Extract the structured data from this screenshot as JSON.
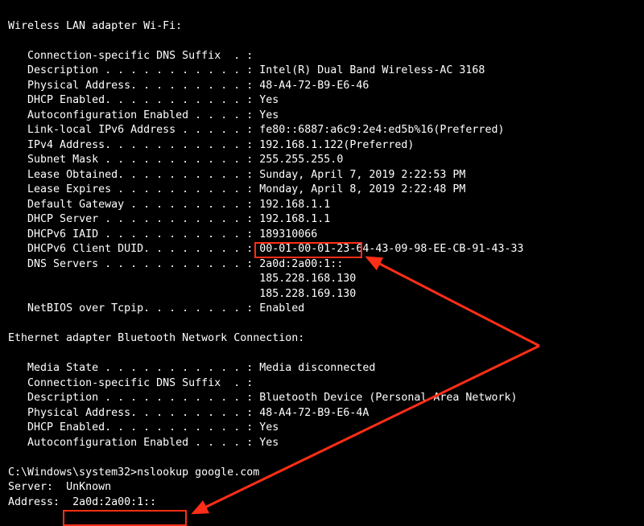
{
  "wifi": {
    "header": "Wireless LAN adapter Wi-Fi:",
    "rows": [
      {
        "label": "Connection-specific DNS Suffix  . :",
        "value": ""
      },
      {
        "label": "Description . . . . . . . . . . . :",
        "value": "Intel(R) Dual Band Wireless-AC 3168"
      },
      {
        "label": "Physical Address. . . . . . . . . :",
        "value": "48-A4-72-B9-E6-46"
      },
      {
        "label": "DHCP Enabled. . . . . . . . . . . :",
        "value": "Yes"
      },
      {
        "label": "Autoconfiguration Enabled . . . . :",
        "value": "Yes"
      },
      {
        "label": "Link-local IPv6 Address . . . . . :",
        "value": "fe80::6887:a6c9:2e4:ed5b%16(Preferred)"
      },
      {
        "label": "IPv4 Address. . . . . . . . . . . :",
        "value": "192.168.1.122(Preferred)"
      },
      {
        "label": "Subnet Mask . . . . . . . . . . . :",
        "value": "255.255.255.0"
      },
      {
        "label": "Lease Obtained. . . . . . . . . . :",
        "value": "Sunday, April 7, 2019 2:22:53 PM"
      },
      {
        "label": "Lease Expires . . . . . . . . . . :",
        "value": "Monday, April 8, 2019 2:22:48 PM"
      },
      {
        "label": "Default Gateway . . . . . . . . . :",
        "value": "192.168.1.1"
      },
      {
        "label": "DHCP Server . . . . . . . . . . . :",
        "value": "192.168.1.1"
      },
      {
        "label": "DHCPv6 IAID . . . . . . . . . . . :",
        "value": "189310066"
      },
      {
        "label": "DHCPv6 Client DUID. . . . . . . . :",
        "value": "00-01-00-01-23-64-43-09-98-EE-CB-91-43-33"
      },
      {
        "label": "DNS Servers . . . . . . . . . . . :",
        "value": "2a0d:2a00:1::"
      }
    ],
    "dns_extra": [
      "185.228.168.130",
      "185.228.169.130"
    ],
    "netbios": {
      "label": "NetBIOS over Tcpip. . . . . . . . :",
      "value": "Enabled"
    }
  },
  "bt": {
    "header": "Ethernet adapter Bluetooth Network Connection:",
    "rows": [
      {
        "label": "Media State . . . . . . . . . . . :",
        "value": "Media disconnected"
      },
      {
        "label": "Connection-specific DNS Suffix  . :",
        "value": ""
      },
      {
        "label": "Description . . . . . . . . . . . :",
        "value": "Bluetooth Device (Personal Area Network)"
      },
      {
        "label": "Physical Address. . . . . . . . . :",
        "value": "48-A4-72-B9-E6-4A"
      },
      {
        "label": "DHCP Enabled. . . . . . . . . . . :",
        "value": "Yes"
      },
      {
        "label": "Autoconfiguration Enabled . . . . :",
        "value": "Yes"
      }
    ]
  },
  "prompt": {
    "path": "C:\\Windows\\system32>",
    "cmd": "nslookup google.com"
  },
  "ns": {
    "server_label": "Server:  ",
    "server_value": "UnKnown",
    "addr_label": "Address:  ",
    "addr_value": "2a0d:2a00:1::"
  },
  "annotation": {
    "highlight_color": "#ff2e17"
  }
}
